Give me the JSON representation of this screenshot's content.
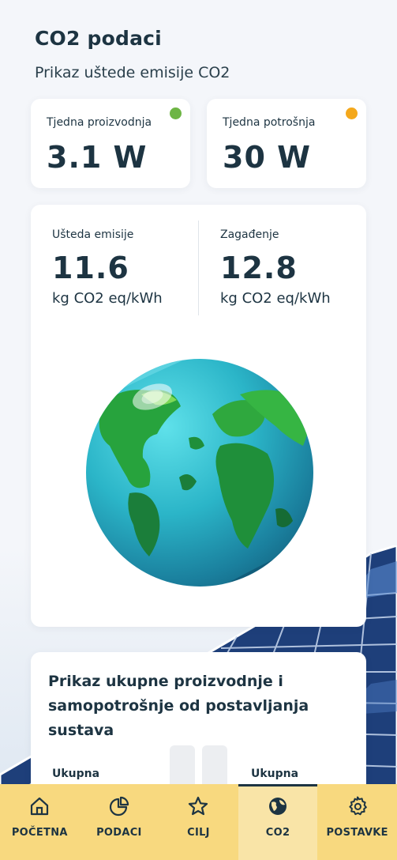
{
  "header": {
    "title": "CO2 podaci",
    "subtitle": "Prikaz uštede emisije CO2"
  },
  "stats": {
    "production": {
      "label": "Tjedna proizvodnja",
      "value": "3.1 W",
      "dot_color": "#6db544"
    },
    "consumption": {
      "label": "Tjedna potrošnja",
      "value": "30 W",
      "dot_color": "#f4a81c"
    }
  },
  "emissions": {
    "saving": {
      "label": "Ušteda emisije",
      "value": "11.6",
      "unit": "kg CO2 eq/kWh"
    },
    "pollution": {
      "label": "Zagađenje",
      "value": "12.8",
      "unit": "kg CO2 eq/kWh"
    },
    "illustration": "earth-globe-icon"
  },
  "summary": {
    "title": "Prikaz ukupne proizvodnje i samopotrošnje od postavljanja sustava",
    "left_label": "Ukupna",
    "right_label": "Ukupna",
    "bars": [
      {
        "fill_fraction": 0.3,
        "color": "#6db544"
      },
      {
        "fill_fraction": 0.0,
        "color": "#eceef1"
      }
    ]
  },
  "nav": {
    "items": [
      {
        "label": "POČETNA",
        "icon": "home-icon"
      },
      {
        "label": "PODACI",
        "icon": "pie-chart-icon"
      },
      {
        "label": "CILJ",
        "icon": "star-icon"
      },
      {
        "label": "CO2",
        "icon": "globe-icon",
        "active": true
      },
      {
        "label": "POSTAVKE",
        "icon": "gear-icon"
      }
    ]
  },
  "colors": {
    "accent_nav": "#f8d97f",
    "text_dark": "#1d3442",
    "green": "#6db544",
    "orange": "#f4a81c"
  }
}
